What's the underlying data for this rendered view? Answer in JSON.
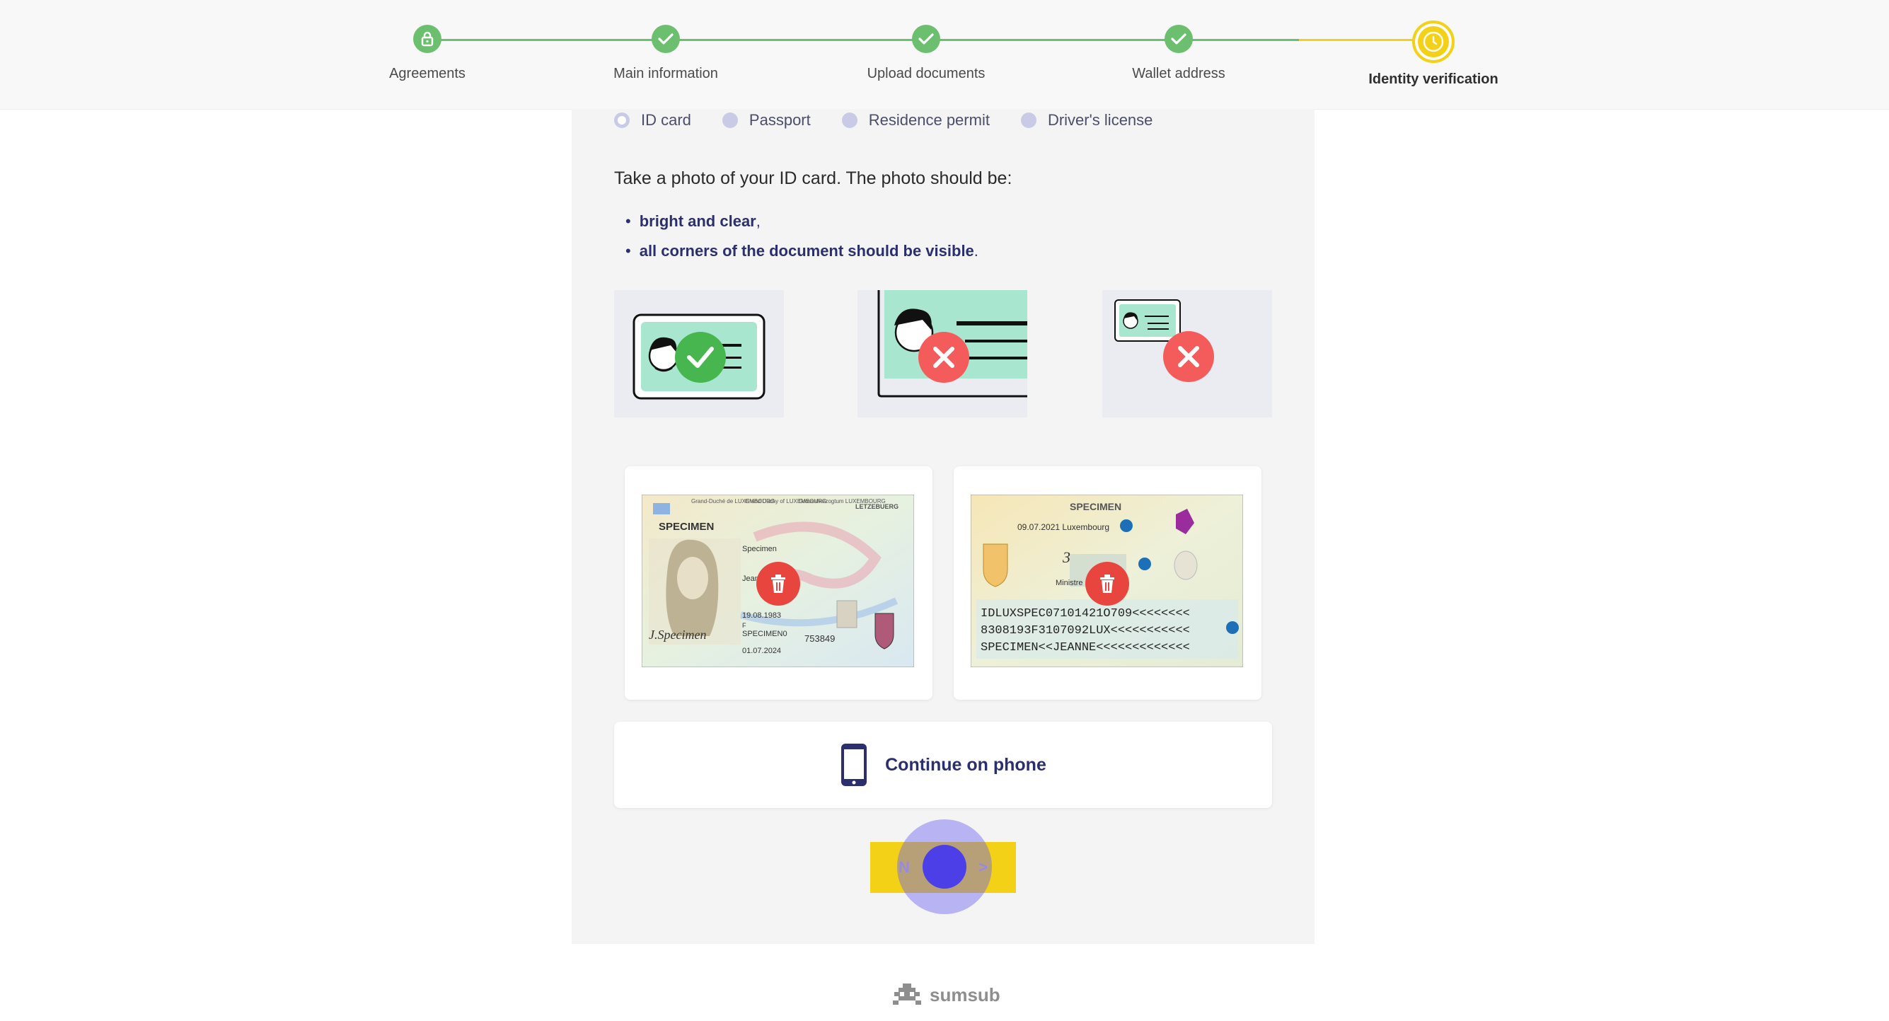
{
  "stepper": {
    "steps": [
      {
        "label": "Agreements",
        "state": "completed",
        "icon": "lock-icon"
      },
      {
        "label": "Main information",
        "state": "completed",
        "icon": "check-icon"
      },
      {
        "label": "Upload documents",
        "state": "completed",
        "icon": "check-icon"
      },
      {
        "label": "Wallet address",
        "state": "completed",
        "icon": "check-icon"
      },
      {
        "label": "Identity verification",
        "state": "active",
        "icon": "clock-icon"
      }
    ]
  },
  "document_types": {
    "options": [
      {
        "label": "ID card",
        "selected": true
      },
      {
        "label": "Passport",
        "selected": false
      },
      {
        "label": "Residence permit",
        "selected": false
      },
      {
        "label": "Driver's license",
        "selected": false
      }
    ]
  },
  "instructions": {
    "intro": "Take a photo of your ID card. The photo should be:",
    "bullet_1_bold": "bright and clear",
    "bullet_1_tail": ",",
    "bullet_2_bold": "all corners of the document should be visible",
    "bullet_2_tail": "."
  },
  "uploads": {
    "front": {
      "specimen": "SPECIMEN",
      "header_1": "Grand-Duché de LUXEMBOURG",
      "header_2": "Grand Duchy of LUXEMBOURG",
      "header_3": "Groussherzogtum LUXEMBOURG",
      "header_4": "LETZEBUERG",
      "surname": "Specimen",
      "given": "Jeanne",
      "dob": "19.08.1983",
      "sex": "F",
      "name_field": "SPECIMEN0",
      "expiry": "01.07.2024",
      "number": "753849",
      "signature": "J.Specimen"
    },
    "back": {
      "specimen": "SPECIMEN",
      "issue": "09.07.2021 Luxembourg",
      "minister": "Ministre",
      "mrz_1": "IDLUXSPEC07101421O709<<<<<<<<",
      "mrz_2": "8308193F3107092LUX<<<<<<<<<<<",
      "mrz_3": "SPECIMEN<<JEANNE<<<<<<<<<<<<<"
    }
  },
  "actions": {
    "continue_on_phone": "Continue on phone",
    "next_label_start": "N",
    "next_label_end": ">"
  },
  "footer": {
    "brand": "sumsub"
  },
  "colors": {
    "completed": "#6cbf6e",
    "active": "#f3d116",
    "brand_blue": "#2b2f6e",
    "danger": "#e8453e"
  }
}
